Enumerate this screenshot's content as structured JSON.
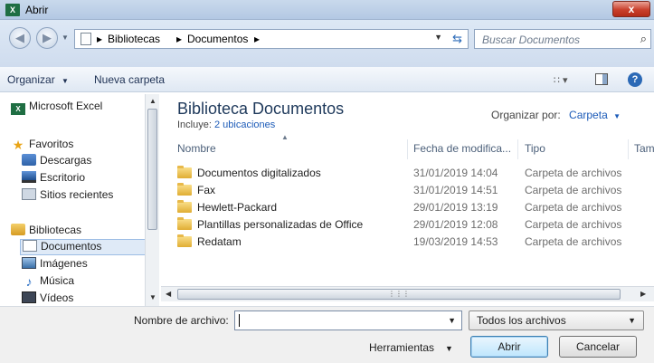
{
  "window": {
    "app_badge": "X",
    "title": "Abrir",
    "close_glyph": "x"
  },
  "address": {
    "back_glyph": "◀",
    "forward_glyph": "▶",
    "crumbs": [
      "Bibliotecas",
      "Documentos"
    ],
    "separator": "▸",
    "dropdown_glyph": "▼",
    "refresh_glyph": "⇆",
    "search_placeholder": "Buscar Documentos",
    "search_icon": "search-icon"
  },
  "toolbar": {
    "organize_label": "Organizar",
    "organize_caret": "▼",
    "new_folder_label": "Nueva carpeta",
    "view_glyph": "∷ ▾",
    "help_glyph": "?"
  },
  "nav": {
    "items": [
      {
        "label": "Microsoft Excel",
        "icon": "excel-icon"
      },
      {
        "label": "Favoritos",
        "icon": "star-icon"
      },
      {
        "label": "Descargas",
        "icon": "downloads-folder-icon"
      },
      {
        "label": "Escritorio",
        "icon": "desktop-icon"
      },
      {
        "label": "Sitios recientes",
        "icon": "recent-places-icon"
      },
      {
        "label": "Bibliotecas",
        "icon": "libraries-icon"
      },
      {
        "label": "Documentos",
        "icon": "documents-icon"
      },
      {
        "label": "Imágenes",
        "icon": "pictures-icon"
      },
      {
        "label": "Música",
        "icon": "music-icon"
      },
      {
        "label": "Vídeos",
        "icon": "videos-icon"
      }
    ],
    "selected": "Documentos"
  },
  "library": {
    "title": "Biblioteca Documentos",
    "includes_label": "Incluye:",
    "includes_link": "2 ubicaciones",
    "arrange_label": "Organizar por:",
    "arrange_value": "Carpeta",
    "arrange_caret": "▼"
  },
  "columns": {
    "name": "Nombre",
    "date": "Fecha de modifica...",
    "type": "Tipo",
    "size": "Tam"
  },
  "files": [
    {
      "name": "Documentos digitalizados",
      "date": "31/01/2019 14:04",
      "type": "Carpeta de archivos"
    },
    {
      "name": "Fax",
      "date": "31/01/2019 14:51",
      "type": "Carpeta de archivos"
    },
    {
      "name": "Hewlett-Packard",
      "date": "29/01/2019 13:19",
      "type": "Carpeta de archivos"
    },
    {
      "name": "Plantillas personalizadas de Office",
      "date": "29/01/2019 12:08",
      "type": "Carpeta de archivos"
    },
    {
      "name": "Redatam",
      "date": "19/03/2019 14:53",
      "type": "Carpeta de archivos"
    }
  ],
  "footer": {
    "filename_label": "Nombre de archivo:",
    "filename_value": "",
    "filter_value": "Todos los archivos",
    "dropdown_glyph": "▼",
    "tools_label": "Herramientas",
    "open_label": "Abrir",
    "cancel_label": "Cancelar"
  },
  "colors": {
    "title_link": "#1c5bb8",
    "library_title": "#1e395b",
    "close_button": "#c9402c",
    "selection_bg": "#dfeaf7"
  }
}
